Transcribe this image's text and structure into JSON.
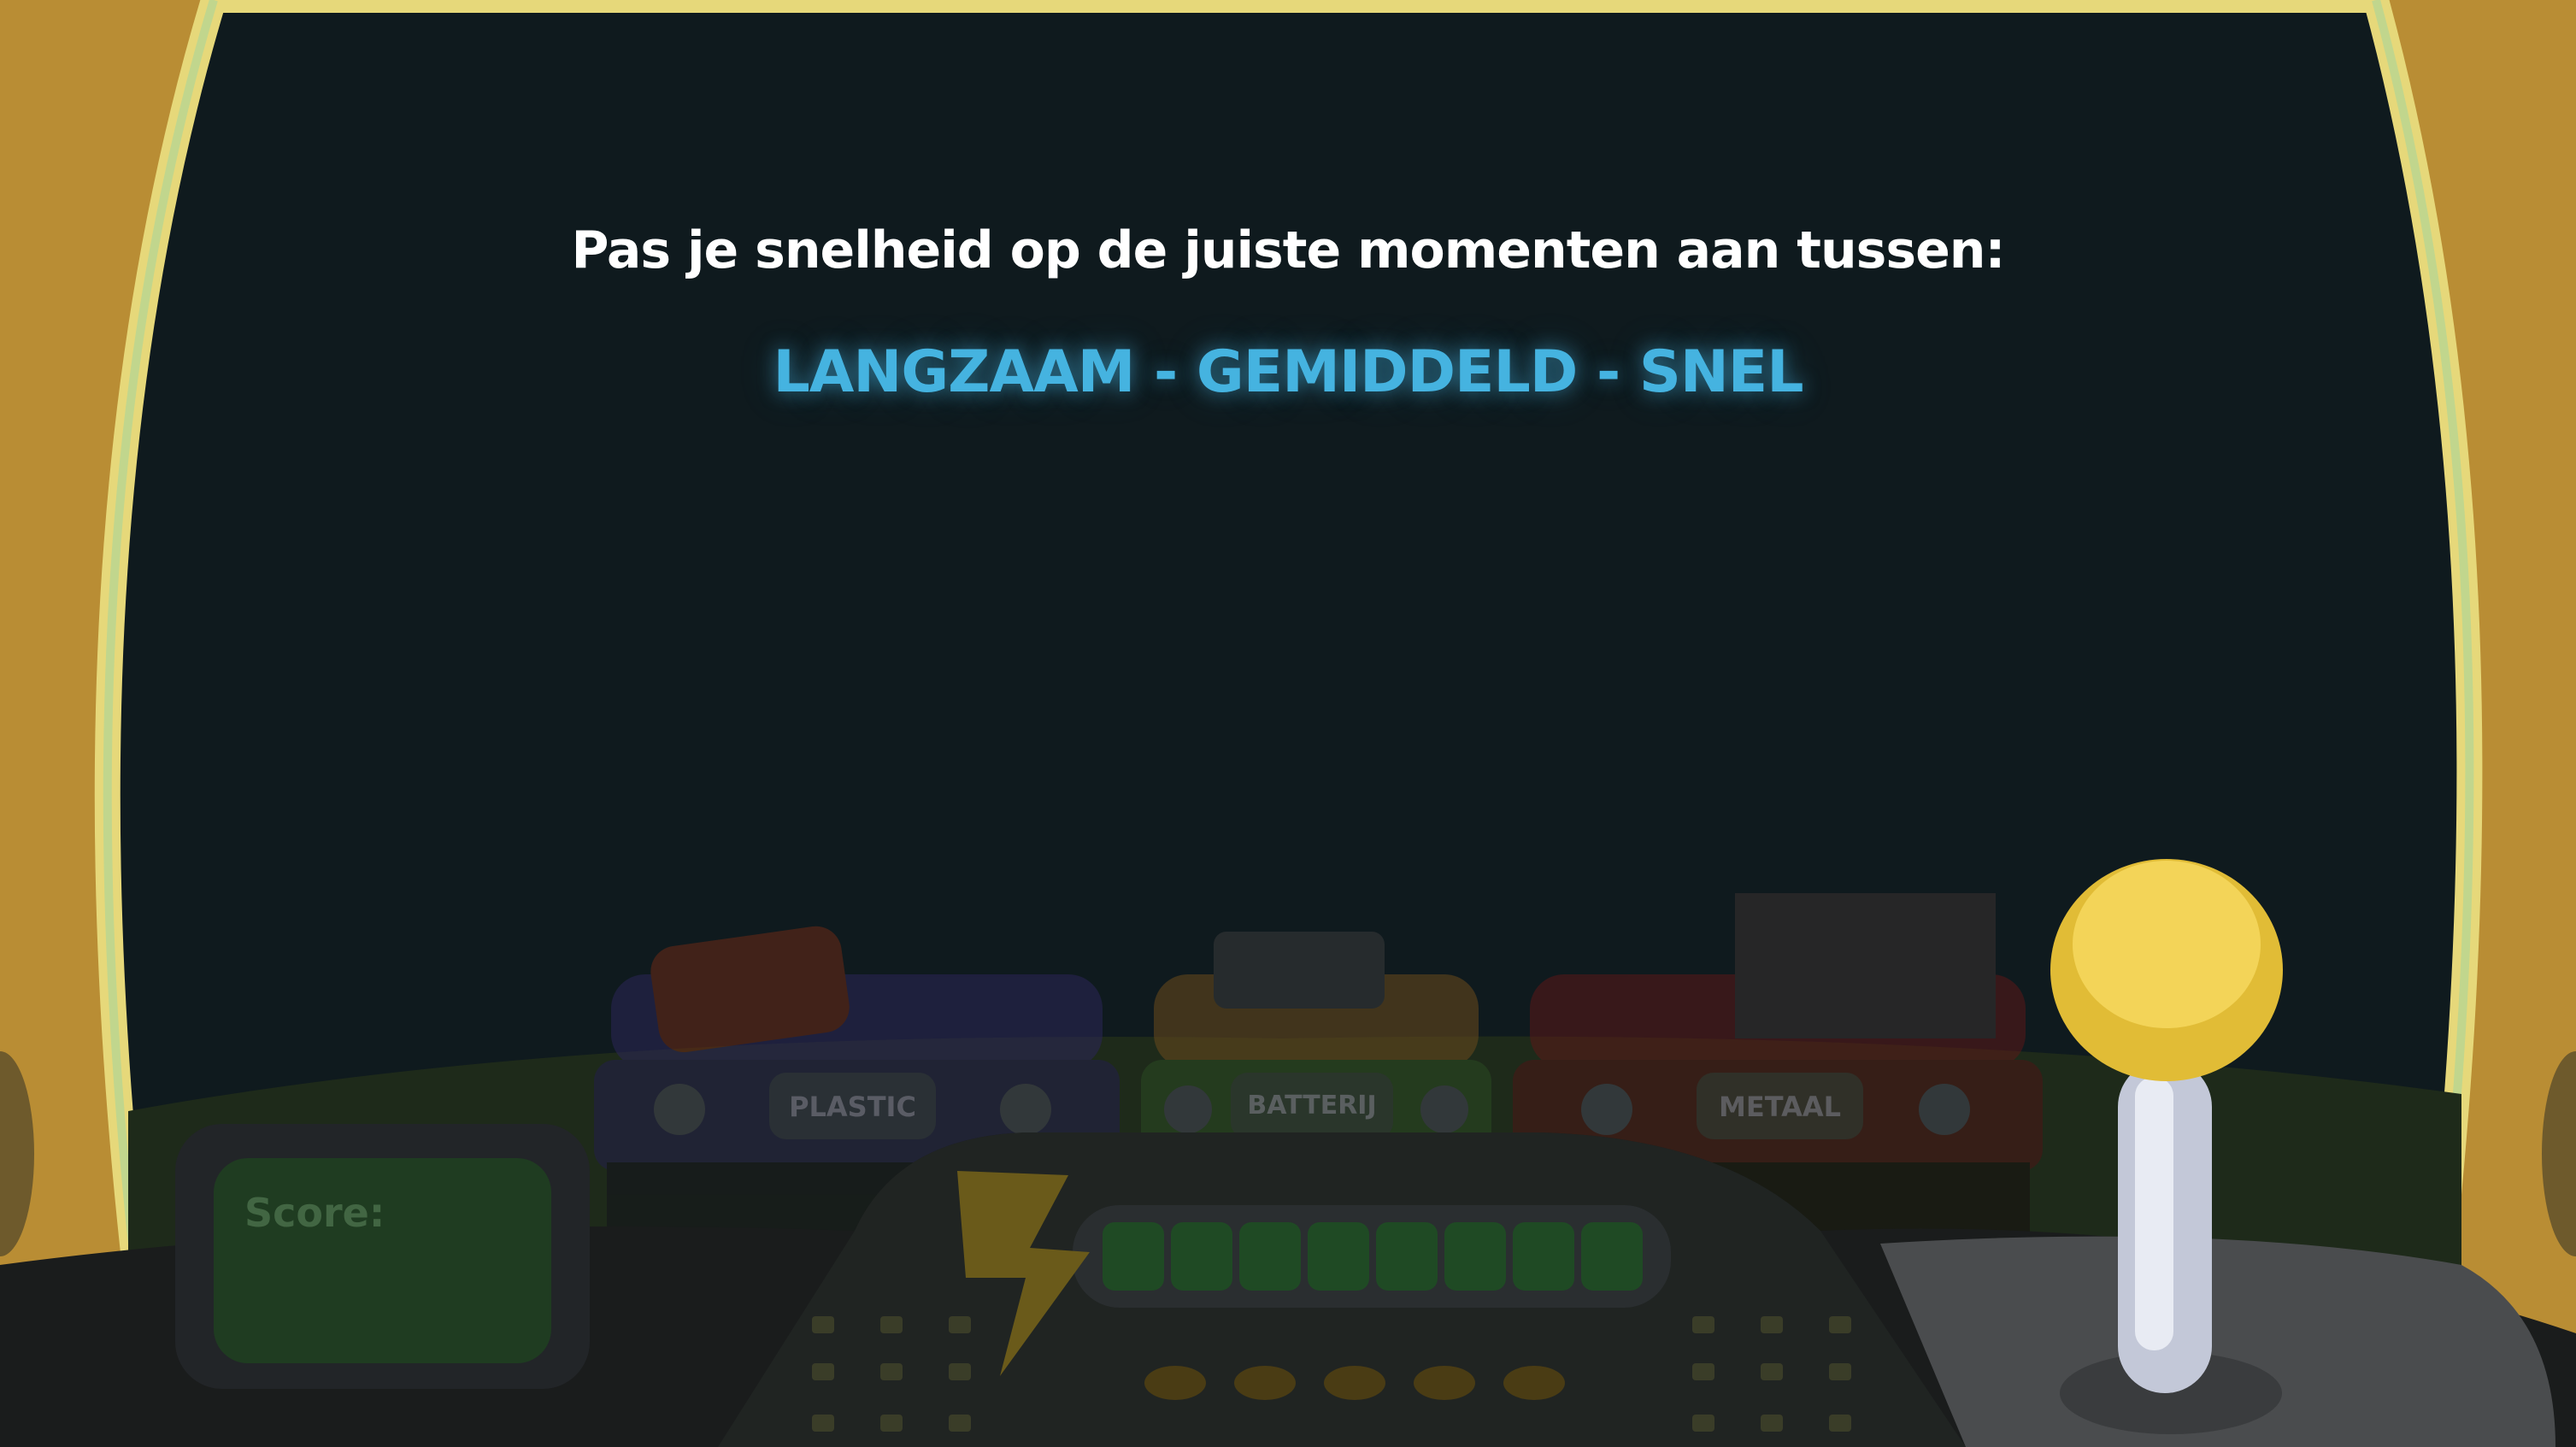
{
  "screen": {
    "instruction": "Pas je snelheid op de juiste momenten aan tussen:",
    "speeds": "LANGZAAM - GEMIDDELD - SNEL"
  },
  "bins": [
    {
      "label": "PLASTIC",
      "color": "#2f2a5e"
    },
    {
      "label": "BATTERIJ",
      "color": "#3f6b2e"
    },
    {
      "label": "METAAL",
      "color": "#6a1f1f"
    }
  ],
  "hud": {
    "score_label": "Score:",
    "energy_segments": 8
  },
  "colors": {
    "cabin_frame": "#b98d34",
    "window_border": "#e6d87a",
    "speed_text": "#45b3e0",
    "lever_knob": "#f3d458"
  },
  "icons": [
    "recycle-icon",
    "lightning-icon"
  ]
}
